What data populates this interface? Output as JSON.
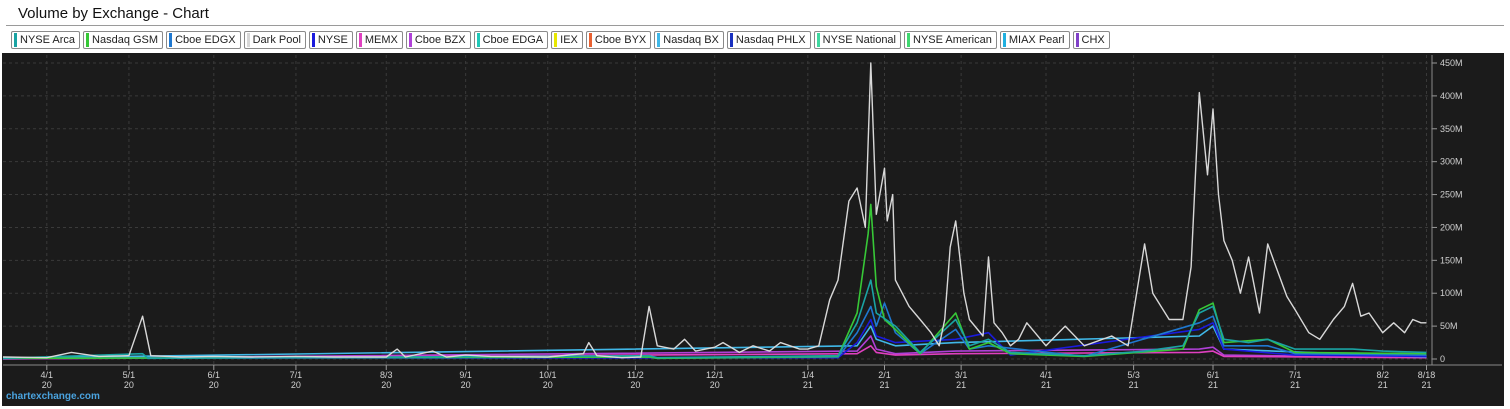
{
  "title": "Volume by Exchange - Chart",
  "watermark": "chartexchange.com",
  "legend": [
    {
      "name": "NYSE Arca",
      "color": "#1aa3a3"
    },
    {
      "name": "Nasdaq GSM",
      "color": "#37c837"
    },
    {
      "name": "Cboe EDGX",
      "color": "#1f78d0"
    },
    {
      "name": "Dark Pool",
      "color": "#d8d8d8"
    },
    {
      "name": "NYSE",
      "color": "#1a1add"
    },
    {
      "name": "MEMX",
      "color": "#e040c0"
    },
    {
      "name": "Cboe BZX",
      "color": "#b040d8"
    },
    {
      "name": "Cboe EDGA",
      "color": "#20c8b8"
    },
    {
      "name": "IEX",
      "color": "#e8e800"
    },
    {
      "name": "Cboe BYX",
      "color": "#e86030"
    },
    {
      "name": "Nasdaq BX",
      "color": "#40b8e8"
    },
    {
      "name": "Nasdaq PHLX",
      "color": "#1830c0"
    },
    {
      "name": "NYSE National",
      "color": "#40d8a0"
    },
    {
      "name": "NYSE American",
      "color": "#40d870"
    },
    {
      "name": "MIAX Pearl",
      "color": "#20b0e0"
    },
    {
      "name": "CHX",
      "color": "#8040c8"
    }
  ],
  "chart_data": {
    "type": "line",
    "title": "Volume by Exchange - Chart",
    "ylim": [
      0,
      450000000
    ],
    "yticks": [
      "0",
      "50M",
      "100M",
      "150M",
      "200M",
      "250M",
      "300M",
      "350M",
      "400M",
      "450M"
    ],
    "x_range": [
      "2020-03-16",
      "2021-08-20"
    ],
    "xticks": [
      {
        "date": "2020-04-01",
        "line1": "4/1",
        "line2": "20"
      },
      {
        "date": "2020-05-01",
        "line1": "5/1",
        "line2": "20"
      },
      {
        "date": "2020-06-01",
        "line1": "6/1",
        "line2": "20"
      },
      {
        "date": "2020-07-01",
        "line1": "7/1",
        "line2": "20"
      },
      {
        "date": "2020-08-03",
        "line1": "8/3",
        "line2": "20"
      },
      {
        "date": "2020-09-01",
        "line1": "9/1",
        "line2": "20"
      },
      {
        "date": "2020-10-01",
        "line1": "10/1",
        "line2": "20"
      },
      {
        "date": "2020-11-02",
        "line1": "11/2",
        "line2": "20"
      },
      {
        "date": "2020-12-01",
        "line1": "12/1",
        "line2": "20"
      },
      {
        "date": "2021-01-04",
        "line1": "1/4",
        "line2": "21"
      },
      {
        "date": "2021-02-01",
        "line1": "2/1",
        "line2": "21"
      },
      {
        "date": "2021-03-01",
        "line1": "3/1",
        "line2": "21"
      },
      {
        "date": "2021-04-01",
        "line1": "4/1",
        "line2": "21"
      },
      {
        "date": "2021-05-03",
        "line1": "5/3",
        "line2": "21"
      },
      {
        "date": "2021-06-01",
        "line1": "6/1",
        "line2": "21"
      },
      {
        "date": "2021-07-01",
        "line1": "7/1",
        "line2": "21"
      },
      {
        "date": "2021-08-02",
        "line1": "8/2",
        "line2": "21"
      },
      {
        "date": "2021-08-18",
        "line1": "8/18",
        "line2": "21"
      }
    ],
    "grid": true,
    "legend_position": "top",
    "series": [
      {
        "name": "Dark Pool",
        "color": "#d8d8d8",
        "points": [
          [
            "2020-03-16",
            3
          ],
          [
            "2020-04-01",
            2
          ],
          [
            "2020-04-10",
            10
          ],
          [
            "2020-04-20",
            4
          ],
          [
            "2020-05-01",
            5
          ],
          [
            "2020-05-06",
            65
          ],
          [
            "2020-05-09",
            5
          ],
          [
            "2020-05-20",
            3
          ],
          [
            "2020-06-01",
            4
          ],
          [
            "2020-06-15",
            3
          ],
          [
            "2020-07-01",
            4
          ],
          [
            "2020-07-15",
            3
          ],
          [
            "2020-08-03",
            3
          ],
          [
            "2020-08-07",
            15
          ],
          [
            "2020-08-10",
            3
          ],
          [
            "2020-08-20",
            12
          ],
          [
            "2020-08-25",
            3
          ],
          [
            "2020-09-01",
            6
          ],
          [
            "2020-09-10",
            4
          ],
          [
            "2020-10-01",
            3
          ],
          [
            "2020-10-14",
            8
          ],
          [
            "2020-10-16",
            25
          ],
          [
            "2020-10-19",
            5
          ],
          [
            "2020-10-28",
            2
          ],
          [
            "2020-11-04",
            3
          ],
          [
            "2020-11-07",
            80
          ],
          [
            "2020-11-10",
            20
          ],
          [
            "2020-11-16",
            15
          ],
          [
            "2020-11-20",
            30
          ],
          [
            "2020-11-24",
            12
          ],
          [
            "2020-12-01",
            18
          ],
          [
            "2020-12-04",
            25
          ],
          [
            "2020-12-10",
            10
          ],
          [
            "2020-12-15",
            20
          ],
          [
            "2020-12-21",
            12
          ],
          [
            "2020-12-25",
            25
          ],
          [
            "2021-01-01",
            15
          ],
          [
            "2021-01-04",
            15
          ],
          [
            "2021-01-08",
            20
          ],
          [
            "2021-01-12",
            90
          ],
          [
            "2021-01-15",
            120
          ],
          [
            "2021-01-19",
            240
          ],
          [
            "2021-01-22",
            260
          ],
          [
            "2021-01-25",
            200
          ],
          [
            "2021-01-27",
            450
          ],
          [
            "2021-01-29",
            220
          ],
          [
            "2021-02-01",
            290
          ],
          [
            "2021-02-02",
            210
          ],
          [
            "2021-02-04",
            250
          ],
          [
            "2021-02-05",
            120
          ],
          [
            "2021-02-10",
            80
          ],
          [
            "2021-02-14",
            60
          ],
          [
            "2021-02-18",
            40
          ],
          [
            "2021-02-21",
            20
          ],
          [
            "2021-02-23",
            60
          ],
          [
            "2021-02-25",
            170
          ],
          [
            "2021-02-27",
            210
          ],
          [
            "2021-03-02",
            100
          ],
          [
            "2021-03-04",
            60
          ],
          [
            "2021-03-09",
            35
          ],
          [
            "2021-03-11",
            155
          ],
          [
            "2021-03-13",
            55
          ],
          [
            "2021-03-16",
            40
          ],
          [
            "2021-03-19",
            20
          ],
          [
            "2021-03-22",
            30
          ],
          [
            "2021-03-25",
            55
          ],
          [
            "2021-04-01",
            20
          ],
          [
            "2021-04-08",
            50
          ],
          [
            "2021-04-15",
            20
          ],
          [
            "2021-04-25",
            35
          ],
          [
            "2021-05-01",
            20
          ],
          [
            "2021-05-07",
            175
          ],
          [
            "2021-05-10",
            100
          ],
          [
            "2021-05-13",
            80
          ],
          [
            "2021-05-16",
            60
          ],
          [
            "2021-05-21",
            60
          ],
          [
            "2021-05-24",
            140
          ],
          [
            "2021-05-27",
            405
          ],
          [
            "2021-05-30",
            280
          ],
          [
            "2021-06-01",
            380
          ],
          [
            "2021-06-03",
            250
          ],
          [
            "2021-06-05",
            180
          ],
          [
            "2021-06-08",
            150
          ],
          [
            "2021-06-11",
            100
          ],
          [
            "2021-06-14",
            155
          ],
          [
            "2021-06-18",
            70
          ],
          [
            "2021-06-21",
            175
          ],
          [
            "2021-06-24",
            140
          ],
          [
            "2021-06-28",
            95
          ],
          [
            "2021-07-01",
            75
          ],
          [
            "2021-07-06",
            40
          ],
          [
            "2021-07-10",
            30
          ],
          [
            "2021-07-15",
            60
          ],
          [
            "2021-07-19",
            80
          ],
          [
            "2021-07-22",
            115
          ],
          [
            "2021-07-25",
            65
          ],
          [
            "2021-07-28",
            70
          ],
          [
            "2021-08-02",
            40
          ],
          [
            "2021-08-06",
            55
          ],
          [
            "2021-08-10",
            40
          ],
          [
            "2021-08-13",
            60
          ],
          [
            "2021-08-16",
            55
          ],
          [
            "2021-08-18",
            55
          ]
        ]
      },
      {
        "name": "NYSE Arca",
        "color": "#1aa3a3",
        "points": [
          [
            "2020-03-16",
            1
          ],
          [
            "2020-05-06",
            8
          ],
          [
            "2020-05-08",
            1
          ],
          [
            "2020-11-07",
            5
          ],
          [
            "2020-11-10",
            2
          ],
          [
            "2021-01-15",
            5
          ],
          [
            "2021-01-22",
            55
          ],
          [
            "2021-01-27",
            120
          ],
          [
            "2021-01-29",
            70
          ],
          [
            "2021-02-05",
            50
          ],
          [
            "2021-02-14",
            10
          ],
          [
            "2021-02-27",
            60
          ],
          [
            "2021-03-04",
            20
          ],
          [
            "2021-03-11",
            30
          ],
          [
            "2021-03-19",
            10
          ],
          [
            "2021-04-15",
            5
          ],
          [
            "2021-05-07",
            12
          ],
          [
            "2021-05-21",
            20
          ],
          [
            "2021-05-27",
            70
          ],
          [
            "2021-06-01",
            80
          ],
          [
            "2021-06-05",
            30
          ],
          [
            "2021-06-14",
            25
          ],
          [
            "2021-06-21",
            30
          ],
          [
            "2021-07-01",
            15
          ],
          [
            "2021-07-22",
            15
          ],
          [
            "2021-08-02",
            12
          ],
          [
            "2021-08-18",
            10
          ]
        ]
      },
      {
        "name": "Nasdaq GSM",
        "color": "#37c837",
        "points": [
          [
            "2020-03-16",
            1
          ],
          [
            "2020-11-07",
            3
          ],
          [
            "2020-11-10",
            1
          ],
          [
            "2021-01-15",
            4
          ],
          [
            "2021-01-22",
            70
          ],
          [
            "2021-01-26",
            190
          ],
          [
            "2021-01-27",
            235
          ],
          [
            "2021-01-29",
            110
          ],
          [
            "2021-02-01",
            60
          ],
          [
            "2021-02-05",
            45
          ],
          [
            "2021-02-14",
            8
          ],
          [
            "2021-02-27",
            70
          ],
          [
            "2021-03-04",
            15
          ],
          [
            "2021-03-11",
            25
          ],
          [
            "2021-03-19",
            8
          ],
          [
            "2021-04-15",
            4
          ],
          [
            "2021-05-21",
            15
          ],
          [
            "2021-05-27",
            75
          ],
          [
            "2021-06-01",
            85
          ],
          [
            "2021-06-05",
            25
          ],
          [
            "2021-06-21",
            30
          ],
          [
            "2021-07-01",
            10
          ],
          [
            "2021-08-18",
            8
          ]
        ]
      },
      {
        "name": "Cboe EDGX",
        "color": "#1f78d0",
        "points": [
          [
            "2020-03-16",
            1
          ],
          [
            "2020-11-07",
            3
          ],
          [
            "2020-11-10",
            1
          ],
          [
            "2021-01-15",
            3
          ],
          [
            "2021-01-22",
            40
          ],
          [
            "2021-01-27",
            80
          ],
          [
            "2021-01-29",
            50
          ],
          [
            "2021-02-01",
            85
          ],
          [
            "2021-02-05",
            40
          ],
          [
            "2021-02-14",
            8
          ],
          [
            "2021-02-27",
            45
          ],
          [
            "2021-03-04",
            15
          ],
          [
            "2021-03-11",
            20
          ],
          [
            "2021-04-15",
            4
          ],
          [
            "2021-05-27",
            55
          ],
          [
            "2021-06-01",
            65
          ],
          [
            "2021-06-05",
            20
          ],
          [
            "2021-06-21",
            20
          ],
          [
            "2021-07-01",
            8
          ],
          [
            "2021-08-18",
            6
          ]
        ]
      },
      {
        "name": "NYSE",
        "color": "#1a1add",
        "points": [
          [
            "2020-03-16",
            1
          ],
          [
            "2021-01-15",
            2
          ],
          [
            "2021-01-22",
            25
          ],
          [
            "2021-01-27",
            60
          ],
          [
            "2021-01-29",
            35
          ],
          [
            "2021-02-05",
            25
          ],
          [
            "2021-02-27",
            30
          ],
          [
            "2021-03-11",
            40
          ],
          [
            "2021-03-19",
            6
          ],
          [
            "2021-05-27",
            45
          ],
          [
            "2021-06-01",
            55
          ],
          [
            "2021-06-05",
            15
          ],
          [
            "2021-07-01",
            6
          ],
          [
            "2021-08-18",
            4
          ]
        ]
      },
      {
        "name": "Nasdaq BX",
        "color": "#40b8e8",
        "points": [
          [
            "2020-03-16",
            1
          ],
          [
            "2021-01-22",
            20
          ],
          [
            "2021-01-27",
            50
          ],
          [
            "2021-01-29",
            30
          ],
          [
            "2021-02-05",
            20
          ],
          [
            "2021-02-27",
            25
          ],
          [
            "2021-05-27",
            35
          ],
          [
            "2021-06-01",
            50
          ],
          [
            "2021-06-05",
            15
          ],
          [
            "2021-08-18",
            3
          ]
        ]
      },
      {
        "name": "MEMX",
        "color": "#e040c0",
        "points": [
          [
            "2020-03-16",
            0
          ],
          [
            "2021-01-22",
            8
          ],
          [
            "2021-01-27",
            20
          ],
          [
            "2021-01-29",
            10
          ],
          [
            "2021-02-05",
            6
          ],
          [
            "2021-02-27",
            8
          ],
          [
            "2021-05-27",
            10
          ],
          [
            "2021-06-01",
            12
          ],
          [
            "2021-06-05",
            4
          ],
          [
            "2021-08-18",
            2
          ]
        ]
      },
      {
        "name": "Cboe BZX",
        "color": "#b040d8",
        "points": [
          [
            "2020-03-16",
            0
          ],
          [
            "2021-01-22",
            12
          ],
          [
            "2021-01-27",
            35
          ],
          [
            "2021-01-29",
            15
          ],
          [
            "2021-02-05",
            8
          ],
          [
            "2021-02-27",
            12
          ],
          [
            "2021-05-27",
            15
          ],
          [
            "2021-06-01",
            18
          ],
          [
            "2021-06-05",
            6
          ],
          [
            "2021-08-18",
            2
          ]
        ]
      }
    ]
  }
}
